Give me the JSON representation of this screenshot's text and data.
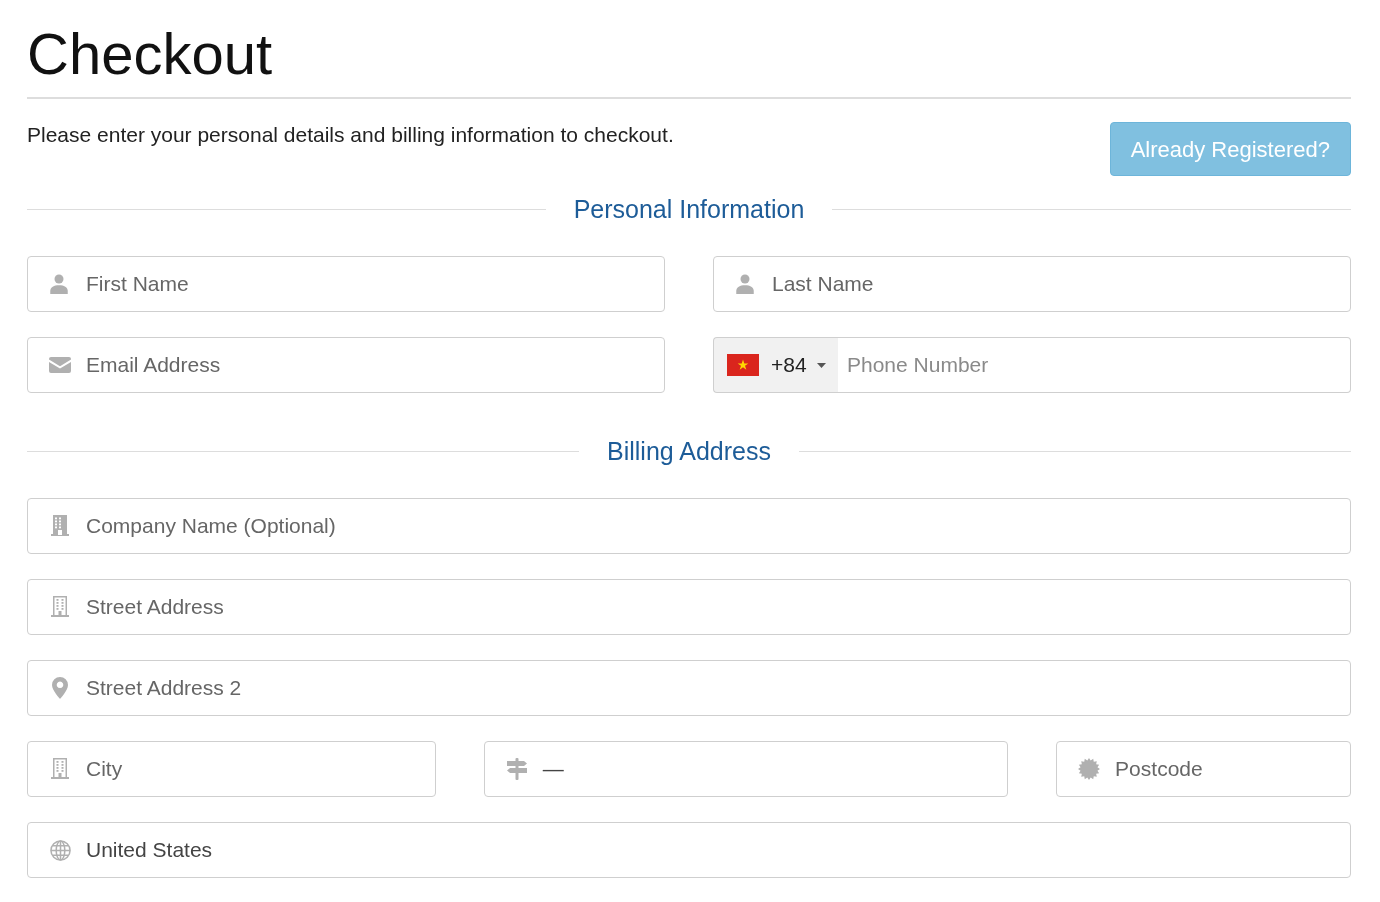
{
  "title": "Checkout",
  "intro": "Please enter your personal details and billing information to checkout.",
  "login_button": {
    "label": "Already Registered?"
  },
  "sections": [
    {
      "heading": "Personal Information",
      "rows": [
        [
          {
            "kind": "name",
            "placeholder": "First Name"
          },
          {
            "kind": "name",
            "placeholder": "Last Name"
          }
        ],
        [
          {
            "kind": "email",
            "placeholder": "Email Address"
          },
          {
            "kind": "phone",
            "country_code": "+84",
            "placeholder": "Phone Number"
          }
        ]
      ]
    },
    {
      "heading": "Billing Address",
      "rows": [
        [
          {
            "kind": "company",
            "placeholder": "Company Name (Optional)"
          }
        ],
        [
          {
            "kind": "street",
            "placeholder": "Street Address"
          }
        ],
        [
          {
            "kind": "address",
            "placeholder": "Street Address 2"
          }
        ],
        [
          {
            "kind": "city",
            "placeholder": "City"
          },
          {
            "kind": "state",
            "value": "—"
          },
          {
            "kind": "postcode",
            "placeholder": "Postcode"
          }
        ],
        [
          {
            "kind": "country",
            "value": "United States"
          }
        ]
      ]
    }
  ]
}
